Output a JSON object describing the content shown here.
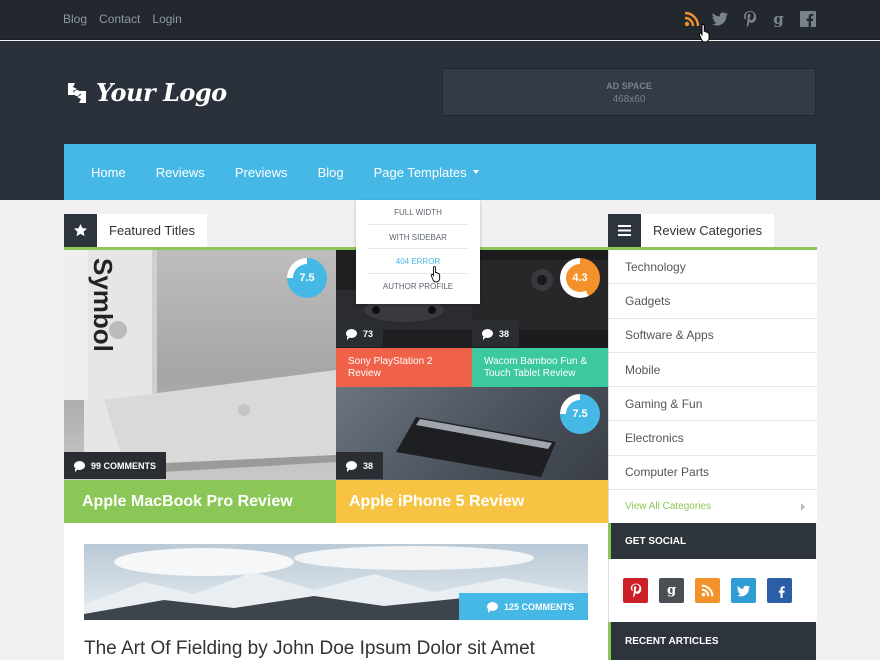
{
  "top_links": [
    "Blog",
    "Contact",
    "Login"
  ],
  "social_top_icons": [
    "rss-icon",
    "twitter-icon",
    "pinterest-icon",
    "google-plus-icon",
    "facebook-icon"
  ],
  "logo": {
    "text": "Your Logo"
  },
  "ad": {
    "line1": "AD SPACE",
    "line2": "468x60"
  },
  "nav": {
    "items": [
      "Home",
      "Reviews",
      "Previews",
      "Blog",
      "Page Templates"
    ]
  },
  "dropdown": {
    "items": [
      "FULL WIDTH",
      "WITH SIDEBAR",
      "404 ERROR",
      "AUTHOR PROFILE"
    ]
  },
  "featured": {
    "heading": "Featured Titles",
    "tiles": [
      {
        "comments": "99 COMMENTS",
        "rating": "7.5",
        "caption": "Apple MacBook Pro Review"
      },
      {
        "comments": "73",
        "caption": "Sony PlayStation 2 Review"
      },
      {
        "comments": "38",
        "rating": "4.3",
        "caption": "Wacom Bamboo Fun & Touch Tablet Review"
      },
      {
        "comments": "38",
        "rating": "7.5",
        "caption": "Apple iPhone 5 Review"
      }
    ]
  },
  "article": {
    "comments": "125 COMMENTS",
    "title": "The Art Of Fielding by John Doe Ipsum Dolor sit Amet"
  },
  "sidebar": {
    "heading": "Review Categories",
    "categories": [
      "Technology",
      "Gadgets",
      "Software & Apps",
      "Mobile",
      "Gaming & Fun",
      "Electronics",
      "Computer Parts"
    ],
    "view_all": "View All Categories",
    "get_social": "GET SOCIAL",
    "recent": "RECENT ARTICLES",
    "social_icons": [
      "pinterest-icon",
      "google-plus-icon",
      "rss-icon",
      "twitter-icon",
      "facebook-icon"
    ]
  },
  "colors": {
    "accent_blue": "#45b8e6",
    "green": "#8bc756",
    "yellow": "#f6c342",
    "red": "#f06149",
    "teal": "#3dc9a0",
    "orange": "#f3922b"
  }
}
